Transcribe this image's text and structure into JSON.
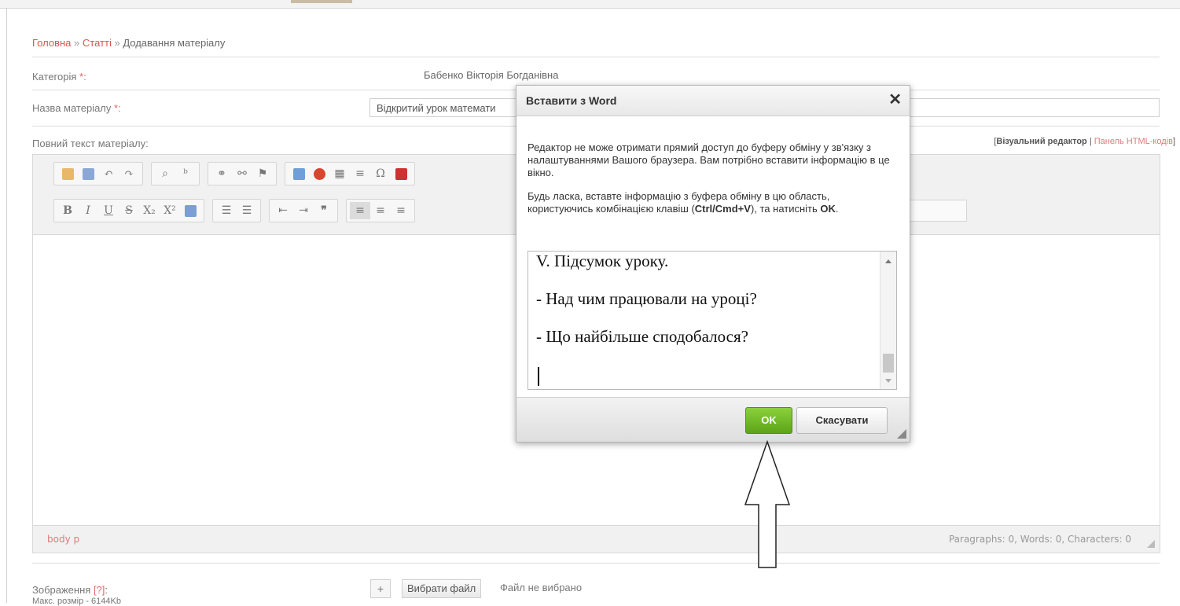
{
  "breadcrumb": {
    "home": "Головна",
    "articles": "Статті",
    "current": "Додавання матеріалу",
    "separator": "»"
  },
  "form": {
    "category_label": "Категорія",
    "category_value": "Бабенко Вікторія Богданівна",
    "required_mark": "*:",
    "title_label": "Назва матеріалу",
    "title_value": "Відкритий урок математи",
    "fulltext_label": "Повний текст матеріалу:",
    "editor_visual": "Візуальний редактор",
    "editor_html": "Панель HTML-кодів",
    "editor_open": "[",
    "editor_sep": "|",
    "editor_close": "]",
    "images_label": "Зображення",
    "images_hint": "[?]",
    "images_colon": ":",
    "max_size": "Макс. розмір - 6144Kb",
    "plus": "+",
    "choose_file": "Вибрати файл",
    "no_file": "Файл не вибрано"
  },
  "editor": {
    "path": "body  p",
    "stats": "Paragraphs: 0, Words: 0, Characters: 0",
    "format_buttons": [
      "B",
      "I",
      "U",
      "S",
      "X₂",
      "X²"
    ]
  },
  "dialog": {
    "title": "Вставити з Word",
    "close": "✕",
    "paragraph1": "Редактор не може отримати прямий доступ до буферу обміну у зв'язку з налаштуваннями Вашого браузера. Вам потрібно вставити інформацію в це вікно.",
    "paragraph2_a": "Будь ласка, вставте інформацію з буфера обміну в цю область, користуючись комбінацією клавіш (",
    "paragraph2_keys": "Ctrl/Cmd+V",
    "paragraph2_b": "), та натисніть ",
    "paragraph2_ok": "OK",
    "paragraph2_end": ".",
    "paste_lines": [
      "V. Підсумок уроку.",
      "- Над чим працювали на уроці?",
      "- Що найбільше сподобалося?"
    ],
    "ok_label": "OK",
    "cancel_label": "Скасувати"
  }
}
